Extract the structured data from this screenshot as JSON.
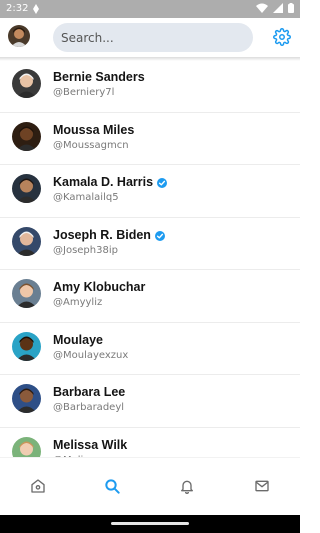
{
  "status_bar": {
    "time": "2:32"
  },
  "header": {
    "search_placeholder": "Search...",
    "accent_color": "#1d9bf0"
  },
  "users": [
    {
      "name": "Bernie Sanders",
      "handle": "@Berniery7l",
      "verified": false,
      "avatar_bg": "#3a3a3a",
      "skin": "#e9c3a5",
      "hair": "#f2f2f2"
    },
    {
      "name": "Moussa Miles",
      "handle": "@Moussagmcn",
      "verified": false,
      "avatar_bg": "#2e1e12",
      "skin": "#6e4224",
      "hair": "#1e120a"
    },
    {
      "name": "Kamala D. Harris",
      "handle": "@Kamalailq5",
      "verified": true,
      "avatar_bg": "#27323f",
      "skin": "#b7835c",
      "hair": "#1d1410"
    },
    {
      "name": "Joseph R. Biden",
      "handle": "@Joseph38ip",
      "verified": true,
      "avatar_bg": "#35496a",
      "skin": "#e2b79b",
      "hair": "#f1f1f1"
    },
    {
      "name": "Amy Klobuchar",
      "handle": "@Amyyliz",
      "verified": false,
      "avatar_bg": "#6a7f92",
      "skin": "#eec6a8",
      "hair": "#7a5230"
    },
    {
      "name": "Moulaye",
      "handle": "@Moulayexzux",
      "verified": false,
      "avatar_bg": "#2aa3c6",
      "skin": "#5b3316",
      "hair": "#1a0f06"
    },
    {
      "name": "Barbara Lee",
      "handle": "@Barbaradeyl",
      "verified": false,
      "avatar_bg": "#2e4f87",
      "skin": "#8a5a3b",
      "hair": "#2b1a10"
    },
    {
      "name": "Melissa Wilk",
      "handle": "@Melissa",
      "verified": false,
      "avatar_bg": "#7bb37a",
      "skin": "#f0cdb2",
      "hair": "#c9955a"
    }
  ],
  "nav": {
    "items": [
      {
        "icon": "home-icon",
        "active": false
      },
      {
        "icon": "search-icon",
        "active": true
      },
      {
        "icon": "bell-icon",
        "active": false
      },
      {
        "icon": "mail-icon",
        "active": false
      }
    ],
    "active_color": "#1d9bf0",
    "inactive_color": "#6b6b6b"
  }
}
